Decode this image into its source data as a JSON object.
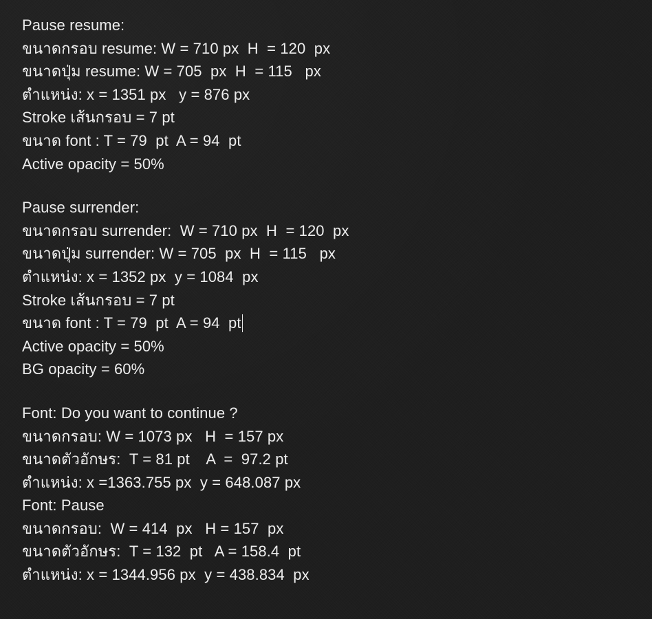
{
  "note": {
    "lines": [
      "Pause resume:",
      "ขนาดกรอบ resume: W = 710 px  H  = 120  px",
      "ขนาดปุ่ม resume: W = 705  px  H  = 115   px",
      "ตำแหน่ง: x = 1351 px   y = 876 px",
      "Stroke เส้นกรอบ = 7 pt",
      "ขนาด font : T = 79  pt  A = 94  pt",
      "Active opacity = 50%",
      "",
      "Pause surrender:",
      "ขนาดกรอบ surrender:  W = 710 px  H  = 120  px",
      "ขนาดปุ่ม surrender: W = 705  px  H  = 115   px",
      "ตำแหน่ง: x = 1352 px  y = 1084  px",
      "Stroke เส้นกรอบ = 7 pt",
      "ขนาด font : T = 79  pt  A = 94  pt",
      "Active opacity = 50%",
      "BG opacity = 60%",
      "",
      "Font: Do you want to continue ?",
      "ขนาดกรอบ: W = 1073 px   H  = 157 px",
      "ขนาดตัวอักษร:  T = 81 pt    A  =  97.2 pt",
      "ตำแหน่ง: x =1363.755 px  y = 648.087 px",
      "Font: Pause",
      "ขนาดกรอบ:  W = 414  px   H = 157  px",
      "ขนาดตัวอักษร:  T = 132  pt   A = 158.4  pt",
      "ตำแหน่ง: x = 1344.956 px  y = 438.834  px"
    ]
  }
}
